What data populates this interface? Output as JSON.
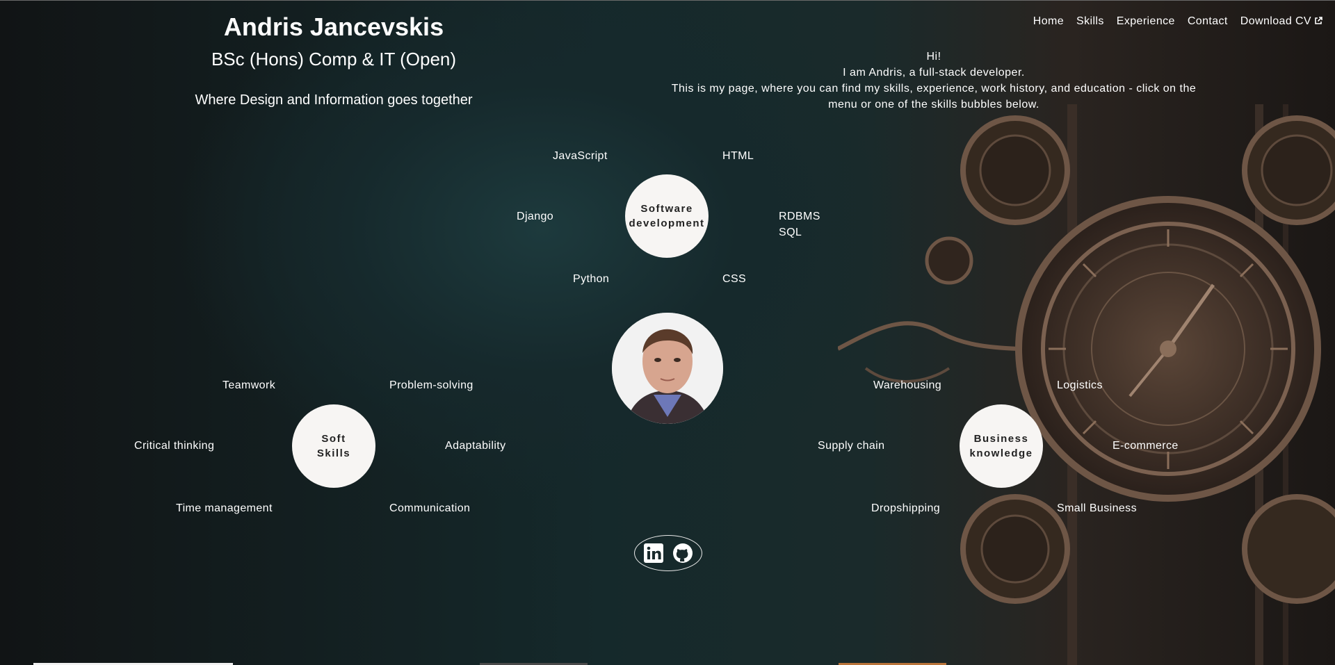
{
  "header": {
    "name": "Andris Jancevskis",
    "degree": "BSc (Hons) Comp & IT (Open)",
    "tagline": "Where Design and Information goes together"
  },
  "nav": {
    "items": [
      "Home",
      "Skills",
      "Experience",
      "Contact"
    ],
    "download_cv": "Download CV"
  },
  "intro": {
    "line1": "Hi!",
    "line2": "I am Andris, a full-stack developer.",
    "line3": "This is my page, where you can find my skills, experience, work history, and education - click on the menu or one of the skills bubbles below."
  },
  "bubbles": {
    "software": {
      "line1": "Software",
      "line2": "development",
      "skills": [
        "JavaScript",
        "HTML",
        "Django",
        "RDBMS",
        "SQL",
        "Python",
        "CSS"
      ]
    },
    "soft": {
      "line1": "Soft",
      "line2": "Skills",
      "skills": [
        "Teamwork",
        "Problem-solving",
        "Critical thinking",
        "Adaptability",
        "Time management",
        "Communication"
      ]
    },
    "business": {
      "line1": "Business",
      "line2": "knowledge",
      "skills": [
        "Warehousing",
        "Logistics",
        "Supply chain",
        "E-commerce",
        "Dropshipping",
        "Small Business"
      ]
    }
  },
  "social": {
    "icons": [
      "linkedin-icon",
      "github-icon"
    ]
  },
  "colors": {
    "bubble_bg": "#f7f5f3",
    "bubble_text": "#222222",
    "text": "#ffffff",
    "bar_white": "#f2f2f2",
    "bar_gray": "#4a4a4a",
    "bar_orange": "#b9743a"
  }
}
